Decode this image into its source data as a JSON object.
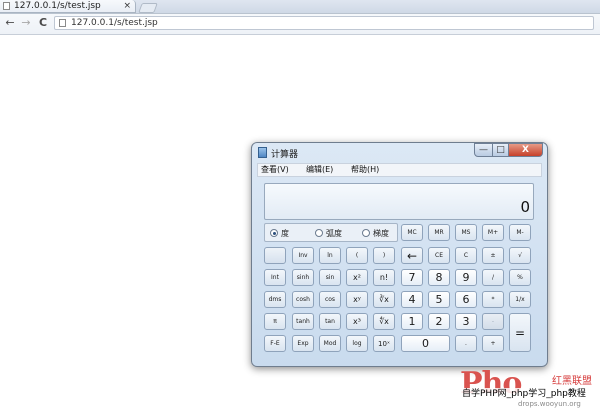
{
  "browser": {
    "tab_title": "127.0.0.1/s/test.jsp",
    "tab_close": "×",
    "back": "←",
    "forward": "→",
    "reload": "C",
    "url": "127.0.0.1/s/test.jsp"
  },
  "calculator": {
    "title": "计算器",
    "controls": {
      "minimize": "—",
      "maximize": "□",
      "close": "X"
    },
    "menu": [
      "查看(V)",
      "编辑(E)",
      "帮助(H)"
    ],
    "display": "0",
    "angle_modes": [
      {
        "label": "度",
        "selected": true
      },
      {
        "label": "弧度",
        "selected": false
      },
      {
        "label": "梯度",
        "selected": false
      }
    ],
    "memory_keys": [
      "MC",
      "MR",
      "MS",
      "M+",
      "M-"
    ],
    "rows": [
      [
        "",
        "Inv",
        "ln",
        "(",
        ")",
        "←",
        "CE",
        "C",
        "±",
        "√"
      ],
      [
        "Int",
        "sinh",
        "sin",
        "x²",
        "n!",
        "7",
        "8",
        "9",
        "/",
        "%"
      ],
      [
        "dms",
        "cosh",
        "cos",
        "xʸ",
        "∛x",
        "4",
        "5",
        "6",
        "*",
        "1/x"
      ],
      [
        "π",
        "tanh",
        "tan",
        "x³",
        "∜x",
        "1",
        "2",
        "3",
        "-",
        "="
      ],
      [
        "F-E",
        "Exp",
        "Mod",
        "log",
        "10ˣ",
        "0",
        ".",
        "+"
      ]
    ]
  },
  "watermark": {
    "logo": "Pho",
    "brand": "红黑联盟",
    "banner": "自学PHP网_php学习_php教程",
    "sub": "drops.wooyun.org"
  }
}
